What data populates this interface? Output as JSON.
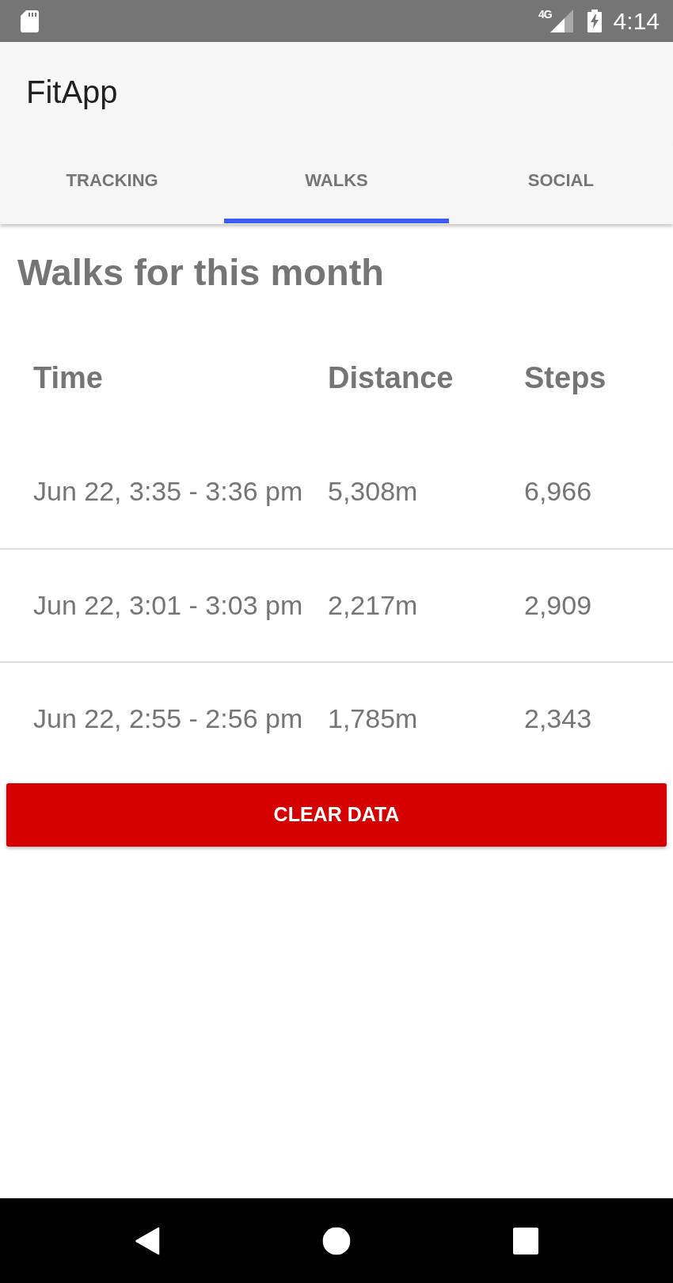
{
  "status_bar": {
    "network": "4G",
    "time": "4:14"
  },
  "app_bar": {
    "title": "FitApp"
  },
  "tabs": [
    {
      "label": "TRACKING",
      "selected": false
    },
    {
      "label": "WALKS",
      "selected": true
    },
    {
      "label": "SOCIAL",
      "selected": false
    }
  ],
  "heading": "Walks for this month",
  "table": {
    "columns": [
      "Time",
      "Distance",
      "Steps"
    ],
    "rows": [
      [
        "Jun 22, 3:35 - 3:36 pm",
        "5,308m",
        "6,966"
      ],
      [
        "Jun 22, 3:01 - 3:03 pm",
        "2,217m",
        "2,909"
      ],
      [
        "Jun 22, 2:55 - 2:56 pm",
        "1,785m",
        "2,343"
      ]
    ]
  },
  "button": {
    "label": "CLEAR DATA"
  }
}
